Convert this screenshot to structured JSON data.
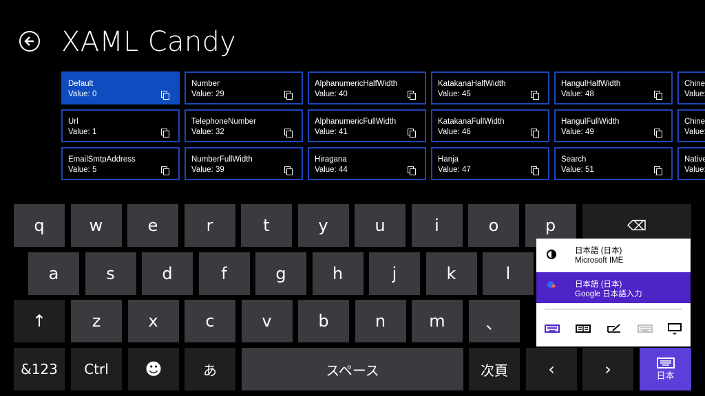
{
  "header": {
    "title": "XAML Candy"
  },
  "tiles": [
    {
      "name": "Default",
      "value": "Value:  0"
    },
    {
      "name": "Url",
      "value": "Value:  1"
    },
    {
      "name": "EmailSmtpAddress",
      "value": "Value:  5"
    },
    {
      "name": "Number",
      "value": "Value:  29"
    },
    {
      "name": "TelephoneNumber",
      "value": "Value:  32"
    },
    {
      "name": "NumberFullWidth",
      "value": "Value:  39"
    },
    {
      "name": "AlphanumericHalfWidth",
      "value": "Value:  40"
    },
    {
      "name": "AlphanumericFullWidth",
      "value": "Value:  41"
    },
    {
      "name": "Hiragana",
      "value": "Value:  44"
    },
    {
      "name": "KatakanaHalfWidth",
      "value": "Value:  45"
    },
    {
      "name": "KatakanaFullWidth",
      "value": "Value:  46"
    },
    {
      "name": "Hanja",
      "value": "Value:  47"
    },
    {
      "name": "HangulHalfWidth",
      "value": "Value:  48"
    },
    {
      "name": "HangulFullWidth",
      "value": "Value:  49"
    },
    {
      "name": "Search",
      "value": "Value:  51"
    },
    {
      "name": "Chines",
      "value": "Value:"
    },
    {
      "name": "Chines",
      "value": "Value:"
    },
    {
      "name": "Native",
      "value": "Value:"
    }
  ],
  "keyboard": {
    "row1": [
      "q",
      "w",
      "e",
      "r",
      "t",
      "y",
      "u",
      "i",
      "o",
      "p"
    ],
    "row2": [
      "a",
      "s",
      "d",
      "f",
      "g",
      "h",
      "j",
      "k",
      "l"
    ],
    "row3": [
      "z",
      "x",
      "c",
      "v",
      "b",
      "n",
      "m",
      "、"
    ],
    "shift": "↑",
    "backspace": "⌫",
    "sym": "&123",
    "ctrl": "Ctrl",
    "emoji": "☻",
    "kana": "あ",
    "space": "スペース",
    "next": "次頁",
    "left": "‹",
    "right": "›",
    "lang": "日本"
  },
  "ime_popup": {
    "items": [
      {
        "line1": "日本語 (日本)",
        "line2": "Microsoft IME",
        "active": false
      },
      {
        "line1": "日本語 (日本)",
        "line2": "Google 日本語入力",
        "active": true
      }
    ]
  },
  "colors": {
    "accent": "#5b3fd8",
    "tile_border": "#1e45b8",
    "tile_selected": "#0f4cc0"
  }
}
